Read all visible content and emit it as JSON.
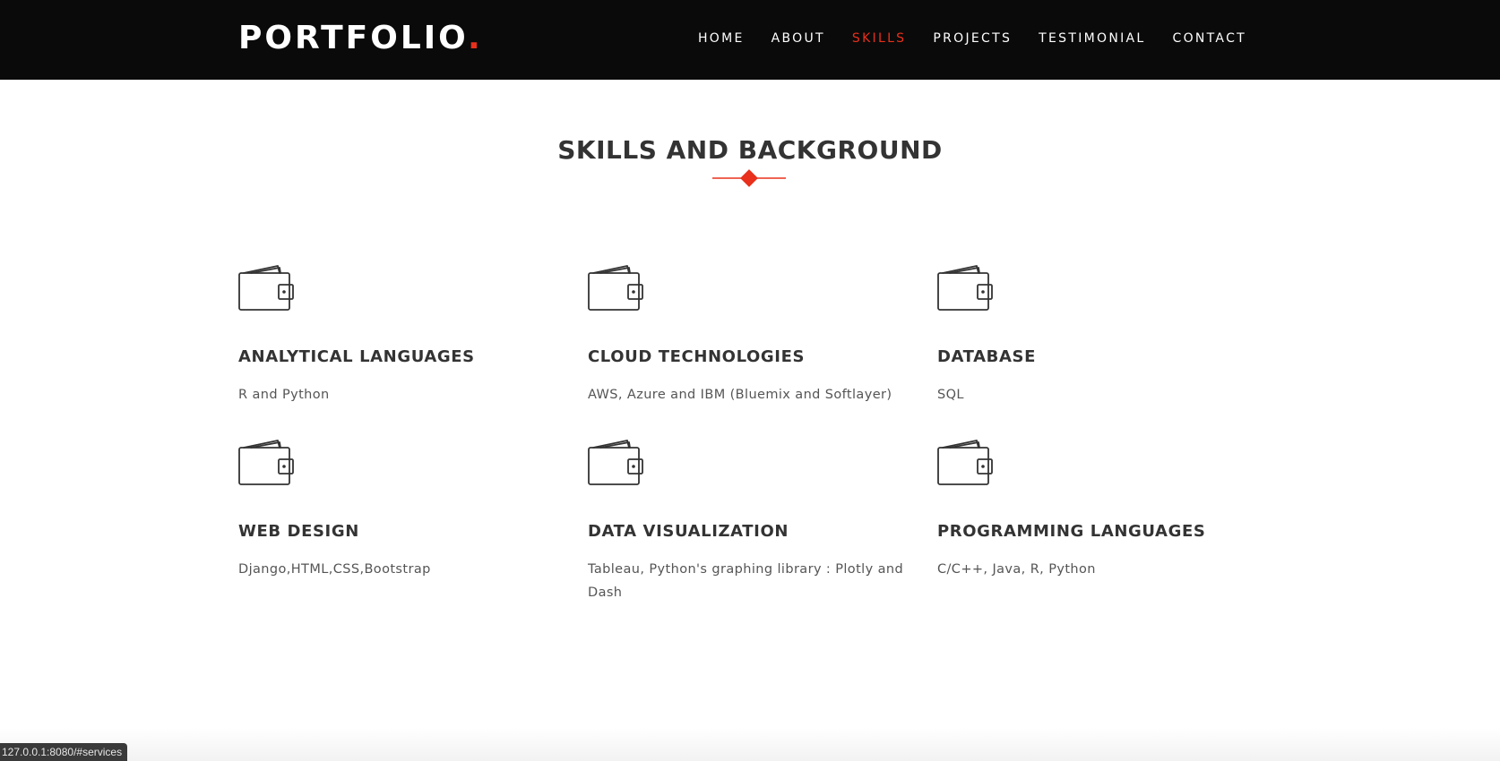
{
  "header": {
    "logo_text": "PORTFOLIO",
    "logo_dot": ".",
    "nav": [
      {
        "label": "HOME",
        "active": false
      },
      {
        "label": "ABOUT",
        "active": false
      },
      {
        "label": "SKILLS",
        "active": true
      },
      {
        "label": "PROJECTS",
        "active": false
      },
      {
        "label": "TESTIMONIAL",
        "active": false
      },
      {
        "label": "CONTACT",
        "active": false
      }
    ]
  },
  "skills": {
    "title": "SKILLS AND BACKGROUND",
    "items": [
      {
        "icon": "wallet-icon",
        "title": "ANALYTICAL LANGUAGES",
        "description": "R and Python"
      },
      {
        "icon": "wallet-icon",
        "title": "CLOUD TECHNOLOGIES",
        "description": "AWS, Azure and IBM (Bluemix and Softlayer)"
      },
      {
        "icon": "wallet-icon",
        "title": "DATABASE",
        "description": "SQL"
      },
      {
        "icon": "wallet-icon",
        "title": "WEB DESIGN",
        "description": "Django,HTML,CSS,Bootstrap"
      },
      {
        "icon": "wallet-icon",
        "title": "DATA VISUALIZATION",
        "description": "Tableau, Python's graphing library : Plotly and Dash"
      },
      {
        "icon": "wallet-icon",
        "title": "PROGRAMMING LANGUAGES",
        "description": "C/C++, Java, R, Python"
      }
    ]
  },
  "status_bar": {
    "url": "127.0.0.1:8080/#services"
  },
  "colors": {
    "accent": "#e8301c",
    "header_bg": "#0a0a0a",
    "heading_text": "#333333",
    "body_text": "#555555"
  }
}
